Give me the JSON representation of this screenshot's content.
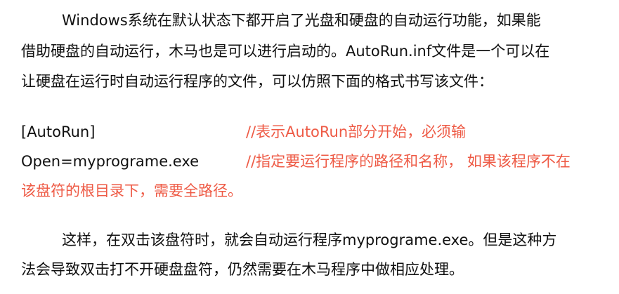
{
  "document": {
    "paragraph1": {
      "line1": "Windows系统在默认状态下都开启了光盘和硬盘的自动运行功能，如果能",
      "line2": "借助硬盘的自动运行，木马也是可以进行启动的。AutoRun.inf文件是一个可以在",
      "line3": "让硬盘在运行时自动运行程序的文件，可以仿照下面的格式书写该文件："
    },
    "code_block": {
      "line1_code": "[AutoRun]",
      "line1_comment": "//表示AutoRun部分开始，必须输",
      "line2_code": "Open=myprograme.exe",
      "line2_comment": "//指定要运行程序的路径和名称， 如果该程序不在",
      "line3_comment": "该盘符的根目录下，需要全路径。"
    },
    "paragraph2": {
      "line1": "这样，在双击该盘符时，就会自动运行程序myprograme.exe。但是这种方",
      "line2": "法会导致双击打不开硬盘盘符，仍然需要在木马程序中做相应处理。"
    },
    "colors": {
      "text": "#111111",
      "comment": "#ee5a45",
      "background": "#ffffff"
    }
  }
}
